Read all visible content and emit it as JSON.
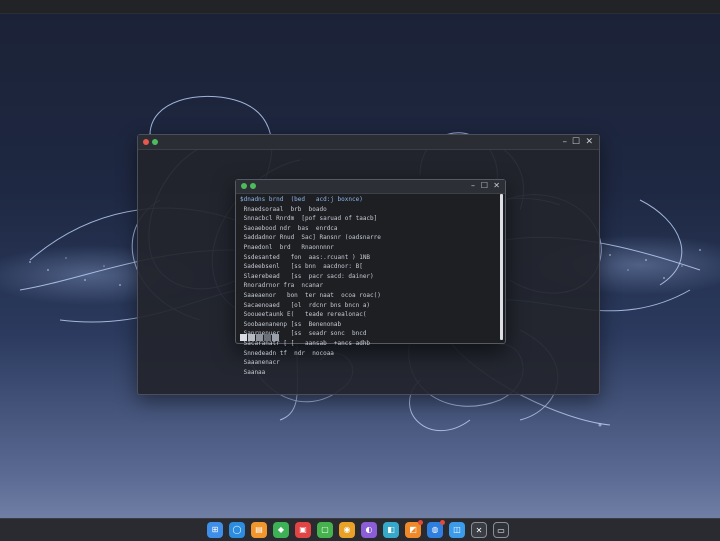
{
  "desktop": {
    "accent_lines": "#a9c4ee",
    "background_top": "#1b2236",
    "background_bottom": "#7b89ad"
  },
  "back_window": {
    "traffic_lights": [
      "#e5584c",
      "#4dbb5c"
    ],
    "controls": {
      "minimize": "–",
      "maximize": "☐",
      "close": "✕"
    }
  },
  "terminal": {
    "traffic_lights": [
      "#4dbb5c",
      "#4dbb5c"
    ],
    "controls": {
      "minimize": "–",
      "maximize": "☐",
      "close": "✕"
    },
    "lines": [
      "$dnadns brnd  (bed   acd:j boxnce)",
      " Rnaedsoraal  brb  boado",
      " Snnacbcl Rnrdm  [pof saruad of taacb]",
      " Saoaebood ndr  bas  enrdca",
      " Saddadnor Rnud  Sac] Ransnr (oadsnarre",
      " Pnaedonl  brd   Rnaonnnnr",
      " Ssdesanted   fon  aas:.rcuant ) 1NB",
      " Sadeebsenl   [ss bnn  aacdnor: B[",
      " Slaerebead   [ss  pacr sacd: dainer)",
      " Rnoradrnor fra  ncanar",
      " Saaeaenor   bon  ter naat  ocoa roac()",
      " Sacaenoaed   [ol  rdcnr bns bncn a)",
      " Sooueetaunk E(   teade rerealonac(",
      " Soobaenanenp [ss  Benenonab",
      " Sanrnenuer   [ss  seadr sonc  bncd",
      " Sacaranatr [ [   aansab  +ancs adhb",
      " Snnedeadn tf  ndr  nocoaa",
      " Saaanenacr",
      " Saanaa"
    ],
    "swatches": [
      "#dadde3",
      "#b6bac2",
      "#8e939c",
      "#6a6f78",
      "#9aa0aa"
    ]
  },
  "dock": {
    "icons": [
      {
        "name": "grid-app-icon",
        "color": "#3f8ee8",
        "glyph": "⊞",
        "badge": false
      },
      {
        "name": "blue-circle-app-icon",
        "color": "#2c8ce0",
        "glyph": "◯",
        "badge": false
      },
      {
        "name": "orange-app-icon",
        "color": "#f0962c",
        "glyph": "▤",
        "badge": false
      },
      {
        "name": "green-app-icon",
        "color": "#3db155",
        "glyph": "◆",
        "badge": false
      },
      {
        "name": "red-app-icon",
        "color": "#e04444",
        "glyph": "▣",
        "badge": false
      },
      {
        "name": "green-square-app-icon",
        "color": "#45b24e",
        "glyph": "▢",
        "badge": false
      },
      {
        "name": "chrome-icon",
        "color": "#e9a227",
        "glyph": "◉",
        "badge": false
      },
      {
        "name": "purple-app-icon",
        "color": "#8b5dd6",
        "glyph": "◐",
        "badge": false
      },
      {
        "name": "teal-app-icon",
        "color": "#36a8c9",
        "glyph": "◧",
        "badge": false
      },
      {
        "name": "orange-badge-app-icon",
        "color": "#ee8a2a",
        "glyph": "◩",
        "badge": true
      },
      {
        "name": "blue-badge-app-icon",
        "color": "#2f7fe0",
        "glyph": "◍",
        "badge": true
      },
      {
        "name": "light-blue-app-icon",
        "color": "#3b9bea",
        "glyph": "◫",
        "badge": false
      },
      {
        "name": "close-app-icon",
        "color": "#3a3d44",
        "glyph": "✕",
        "badge": false
      },
      {
        "name": "trash-icon",
        "color": "#2f3238",
        "glyph": "▭",
        "badge": false
      }
    ]
  }
}
